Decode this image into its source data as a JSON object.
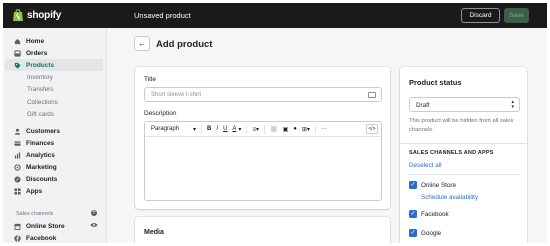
{
  "topbar": {
    "logo_text": "shopify",
    "title": "Unsaved product",
    "discard_label": "Discard",
    "save_label": "Save"
  },
  "sidebar": {
    "items": [
      {
        "label": "Home",
        "icon": "home-icon"
      },
      {
        "label": "Orders",
        "icon": "orders-icon"
      },
      {
        "label": "Products",
        "icon": "tag-icon",
        "active": true
      },
      {
        "label": "Customers",
        "icon": "customers-icon"
      },
      {
        "label": "Finances",
        "icon": "finances-icon"
      },
      {
        "label": "Analytics",
        "icon": "analytics-icon"
      },
      {
        "label": "Marketing",
        "icon": "marketing-icon"
      },
      {
        "label": "Discounts",
        "icon": "discounts-icon"
      },
      {
        "label": "Apps",
        "icon": "apps-icon"
      }
    ],
    "product_subitems": [
      "Inventory",
      "Transfers",
      "Collections",
      "Gift cards"
    ],
    "sales_channels_title": "Sales channels",
    "channels": [
      {
        "label": "Online Store",
        "icon": "store-icon"
      },
      {
        "label": "Facebook",
        "icon": "facebook-icon"
      }
    ]
  },
  "page": {
    "title": "Add product"
  },
  "main": {
    "title_label": "Title",
    "title_placeholder": "Short sleeve t-shirt",
    "description_label": "Description",
    "toolbar": {
      "format": "Paragraph",
      "bold": "B",
      "italic": "I",
      "underline": "U",
      "color": "A",
      "more": "···",
      "code": "</>"
    }
  },
  "media": {
    "title": "Media"
  },
  "status": {
    "title": "Product status",
    "selected": "Draft",
    "help": "This product will be hidden from all sales channels.",
    "channels_heading": "SALES CHANNELS AND APPS",
    "deselect_all": "Deselect all",
    "channels": [
      "Online Store",
      "Facebook",
      "Google"
    ],
    "schedule": "Schedule availability"
  },
  "colors": {
    "topbar": "#1a1a1a",
    "accent_green": "#007f5f",
    "link_blue": "#2c6ecb"
  }
}
